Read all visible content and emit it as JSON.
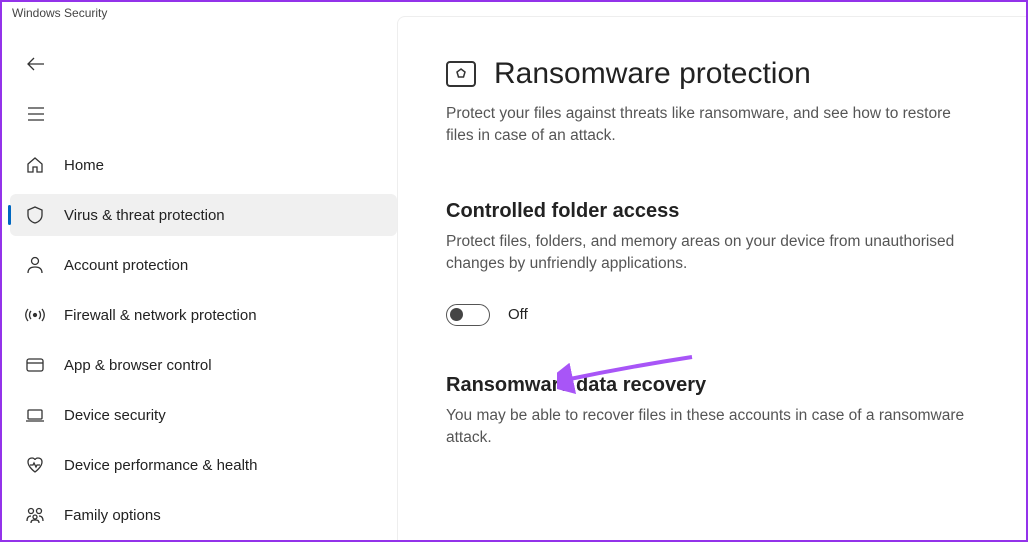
{
  "window": {
    "title": "Windows Security"
  },
  "sidebar": {
    "items": [
      {
        "label": "Home"
      },
      {
        "label": "Virus & threat protection"
      },
      {
        "label": "Account protection"
      },
      {
        "label": "Firewall & network protection"
      },
      {
        "label": "App & browser control"
      },
      {
        "label": "Device security"
      },
      {
        "label": "Device performance & health"
      },
      {
        "label": "Family options"
      }
    ]
  },
  "page": {
    "title": "Ransomware protection",
    "description": "Protect your files against threats like ransomware, and see how to restore files in case of an attack."
  },
  "sections": {
    "controlled_folder": {
      "title": "Controlled folder access",
      "description": "Protect files, folders, and memory areas on your device from unauthorised changes by unfriendly applications.",
      "toggle_state": "Off"
    },
    "recovery": {
      "title": "Ransomware data recovery",
      "description": "You may be able to recover files in these accounts in case of a ransomware attack."
    }
  }
}
